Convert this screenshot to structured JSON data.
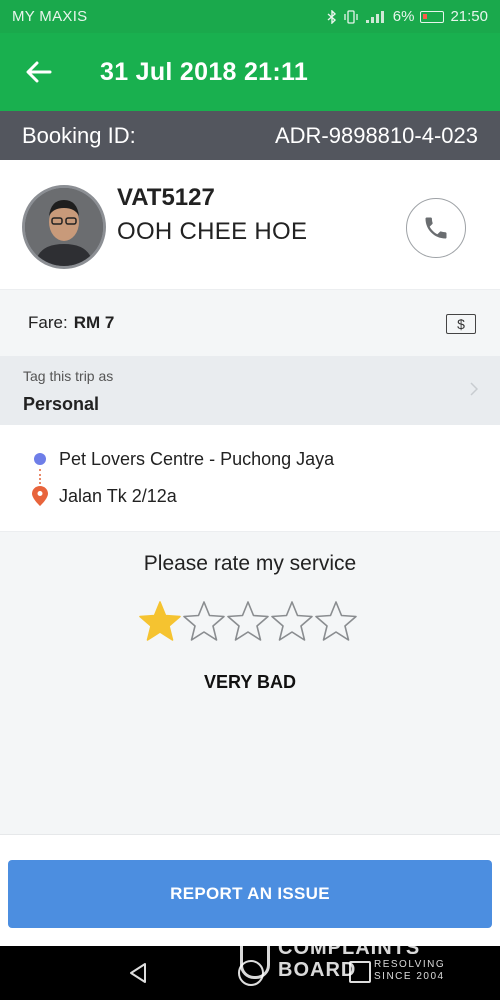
{
  "status_bar": {
    "carrier": "MY MAXIS",
    "battery": "6%",
    "time": "21:50"
  },
  "header": {
    "title": "31 Jul 2018 21:11",
    "back_icon": "arrow-left-icon"
  },
  "booking": {
    "label": "Booking ID:",
    "id": "ADR-9898810-4-023"
  },
  "driver": {
    "plate": "VAT5127",
    "name": "OOH CHEE HOE",
    "call_icon": "phone-icon"
  },
  "fare": {
    "label": "Fare:",
    "value": "RM 7",
    "icon": "cash-icon"
  },
  "tag": {
    "label": "Tag this trip as",
    "value": "Personal"
  },
  "route": {
    "pickup": "Pet Lovers Centre - Puchong Jaya",
    "dropoff": "Jalan Tk 2/12a"
  },
  "rating": {
    "prompt": "Please rate my service",
    "stars_selected": 1,
    "stars_total": 5,
    "verdict": "VERY BAD",
    "star_color": "#f5c330"
  },
  "actions": {
    "report_label": "REPORT AN ISSUE",
    "report_color": "#4c8ee0"
  },
  "watermark": {
    "line1": "COMPLAINTS",
    "line2": "BOARD",
    "sub1": "RESOLVING",
    "sub2": "SINCE 2004"
  },
  "colors": {
    "brand_green": "#19b04f",
    "booking_bar": "#53565e"
  }
}
